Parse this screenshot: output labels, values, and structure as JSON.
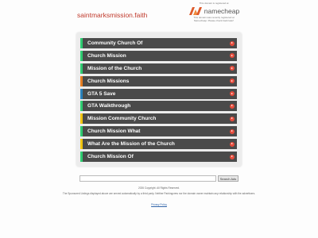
{
  "header": {
    "domain": "saintmarksmission.faith"
  },
  "namecheap": {
    "registered_text": "This domain is registered at",
    "brand": "namecheap",
    "notice_text": "This domain was recently registered at Namecheap. Please check back later!",
    "logo_color": "#de5a2b"
  },
  "links": [
    {
      "label": "Community Church Of",
      "accent": "#2ecc71"
    },
    {
      "label": "Church Mission",
      "accent": "#2ecc71"
    },
    {
      "label": "Mission of the Church",
      "accent": "#2ecc71"
    },
    {
      "label": "Church Missions",
      "accent": "#e67e22"
    },
    {
      "label": "GTA 5 Save",
      "accent": "#2980b9"
    },
    {
      "label": "GTA Walkthrough",
      "accent": "#2ecc71"
    },
    {
      "label": "Mission Community Church",
      "accent": "#f1c40f"
    },
    {
      "label": "Church Mission What",
      "accent": "#2ecc71"
    },
    {
      "label": "What Are the Mission of the Church",
      "accent": "#f1c40f"
    },
    {
      "label": "Church Mission Of",
      "accent": "#2ecc71"
    }
  ],
  "search": {
    "value": "",
    "button_label": "Search Ads"
  },
  "footer": {
    "copyright": "2026 Copyright. All Rights Reserved.",
    "disclaimer": "The Sponsored Listings displayed above are served automatically by a third party. Neither Parkingcrew nor the domain owner maintain any relationship with the advertisers.",
    "privacy_label": "Privacy Policy"
  }
}
